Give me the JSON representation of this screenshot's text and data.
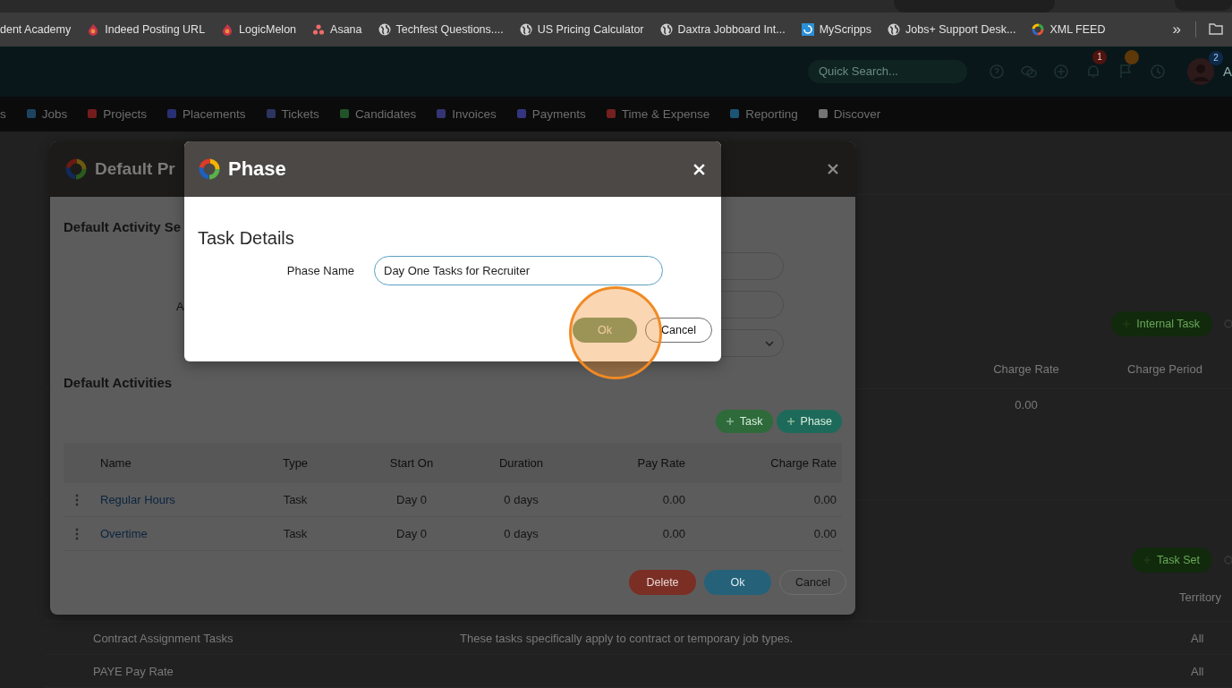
{
  "browser": {
    "bookmarks": [
      {
        "label": "dent Academy"
      },
      {
        "label": "Indeed Posting URL",
        "kind": "flame"
      },
      {
        "label": "LogicMelon",
        "kind": "flame"
      },
      {
        "label": "Asana",
        "kind": "dots"
      },
      {
        "label": "Techfest Questions....",
        "kind": "globe"
      },
      {
        "label": "US Pricing Calculator",
        "kind": "globe"
      },
      {
        "label": "Daxtra Jobboard Int...",
        "kind": "globe"
      },
      {
        "label": "MyScripps",
        "kind": "tile"
      },
      {
        "label": "Jobs+ Support Desk...",
        "kind": "globe"
      },
      {
        "label": "XML FEED",
        "kind": "rings"
      }
    ],
    "more_label": "»"
  },
  "header": {
    "search_placeholder": "Quick Search...",
    "tools": [
      {
        "kind": "help"
      },
      {
        "kind": "chat"
      },
      {
        "kind": "add"
      },
      {
        "kind": "bell",
        "badge": {
          "count": "1",
          "color": "#4e1410"
        }
      },
      {
        "kind": "flag",
        "badge": {
          "color": "#5e3808"
        }
      },
      {
        "kind": "history"
      }
    ],
    "avatar_badge": "2",
    "user_initial": "A"
  },
  "nav": [
    {
      "label": "s"
    },
    {
      "label": "Jobs",
      "color": "#1c4460"
    },
    {
      "label": "Projects",
      "color": "#741c1c"
    },
    {
      "label": "Placements",
      "color": "#283074"
    },
    {
      "label": "Tickets",
      "color": "#2c3460"
    },
    {
      "label": "Candidates",
      "color": "#205428"
    },
    {
      "label": "Invoices",
      "color": "#343474"
    },
    {
      "label": "Payments",
      "color": "#343480"
    },
    {
      "label": "Time & Expense",
      "color": "#742020"
    },
    {
      "label": "Reporting",
      "color": "#1c5474"
    },
    {
      "label": "Discover",
      "color": "#747474"
    }
  ],
  "page": {
    "task_button": "Internal Task",
    "rate_columns": [
      "Charge Rate",
      "Charge Period"
    ],
    "rate_rows": [
      {
        "charge_rate": "0.00"
      }
    ],
    "task_set_button": "Task Set",
    "territory_heading": "Territory",
    "task_sets": [
      {
        "name": "Contract Assignment Tasks",
        "description": "These tasks specifically apply to contract or temporary job types.",
        "territory": "All"
      },
      {
        "name": "PAYE Pay Rate",
        "territory": "All"
      }
    ]
  },
  "activity_dialog": {
    "title": "Default Pr",
    "section": "Default Activity Se",
    "field_label": "A",
    "activities_heading": "Default Activities",
    "add_buttons": [
      {
        "label": "Task",
        "kind": "task"
      },
      {
        "label": "Phase",
        "kind": "phase"
      }
    ],
    "columns": [
      "Name",
      "Type",
      "Start On",
      "Duration",
      "Pay Rate",
      "Charge Rate"
    ],
    "rows": [
      {
        "name": "Regular Hours",
        "type": "Task",
        "start_on": "Day 0",
        "duration": "0 days",
        "pay_rate": "0.00",
        "charge_rate": "0.00"
      },
      {
        "name": "Overtime",
        "type": "Task",
        "start_on": "Day 0",
        "duration": "0 days",
        "pay_rate": "0.00",
        "charge_rate": "0.00"
      }
    ],
    "buttons": [
      {
        "label": "Delete",
        "kind": "danger"
      },
      {
        "label": "Ok",
        "kind": "primary"
      },
      {
        "label": "Cancel",
        "kind": "secondary"
      }
    ]
  },
  "phase_dialog": {
    "title": "Phase",
    "section": "Task Details",
    "field_label": "Phase Name",
    "value": "Day One Tasks for Recruiter",
    "buttons": [
      {
        "label": "Ok",
        "kind": "confirm"
      },
      {
        "label": "Cancel",
        "kind": "secondary"
      }
    ]
  }
}
